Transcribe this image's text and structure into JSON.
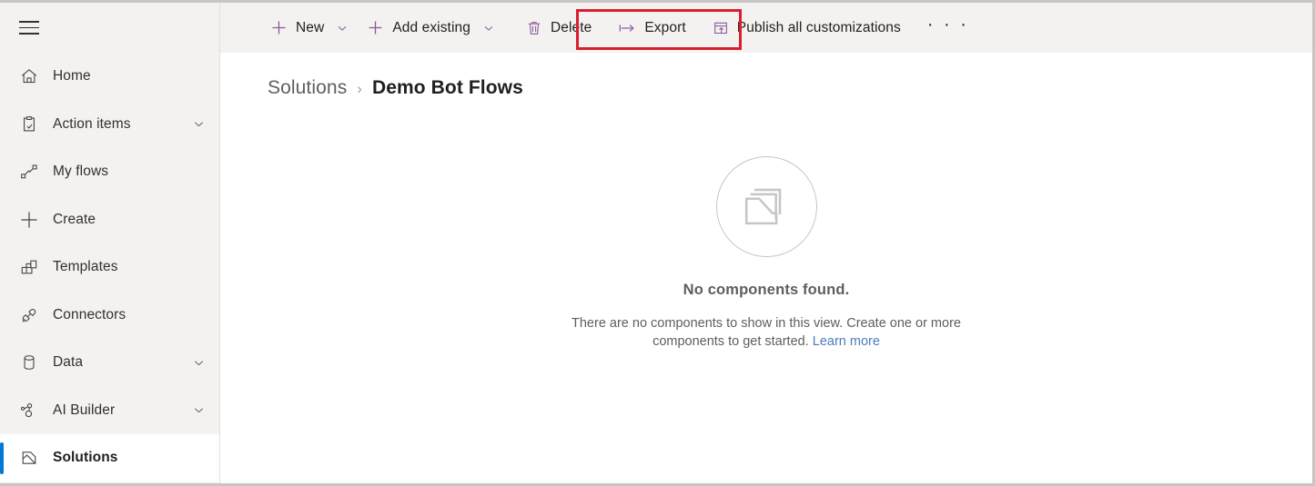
{
  "colors": {
    "accent_purple": "#8a5a9b",
    "highlight_red": "#d91f2d",
    "selected_blue": "#0078d4",
    "link_blue": "#4a7ebb",
    "chrome_gray": "#f3f2f1"
  },
  "sidebar": {
    "menu_button": "menu-icon",
    "items": [
      {
        "label": "Home",
        "icon": "home-icon",
        "has_chevron": false,
        "selected": false
      },
      {
        "label": "Action items",
        "icon": "clipboard-check-icon",
        "has_chevron": true,
        "selected": false
      },
      {
        "label": "My flows",
        "icon": "flow-icon",
        "has_chevron": false,
        "selected": false
      },
      {
        "label": "Create",
        "icon": "plus-icon",
        "has_chevron": false,
        "selected": false
      },
      {
        "label": "Templates",
        "icon": "templates-icon",
        "has_chevron": false,
        "selected": false
      },
      {
        "label": "Connectors",
        "icon": "connectors-icon",
        "has_chevron": false,
        "selected": false
      },
      {
        "label": "Data",
        "icon": "database-icon",
        "has_chevron": true,
        "selected": false
      },
      {
        "label": "AI Builder",
        "icon": "ai-builder-icon",
        "has_chevron": true,
        "selected": false
      },
      {
        "label": "Solutions",
        "icon": "solutions-icon",
        "has_chevron": false,
        "selected": true
      }
    ]
  },
  "toolbar": {
    "buttons": [
      {
        "label": "New",
        "icon": "plus-icon",
        "has_chevron": true,
        "highlighted": false
      },
      {
        "label": "Add existing",
        "icon": "plus-icon",
        "has_chevron": true,
        "highlighted": true
      },
      {
        "label": "Delete",
        "icon": "trash-icon",
        "has_chevron": false,
        "highlighted": false
      },
      {
        "label": "Export",
        "icon": "export-icon",
        "has_chevron": false,
        "highlighted": false
      },
      {
        "label": "Publish all customizations",
        "icon": "publish-icon",
        "has_chevron": false,
        "highlighted": false
      }
    ],
    "overflow_label": "· · ·"
  },
  "breadcrumb": {
    "parent": "Solutions",
    "separator": "›",
    "current": "Demo Bot Flows"
  },
  "empty_state": {
    "icon": "stacked-documents-icon",
    "title": "No components found.",
    "description": "There are no components to show in this view. Create one or more components to get started.",
    "link_text": "Learn more"
  }
}
